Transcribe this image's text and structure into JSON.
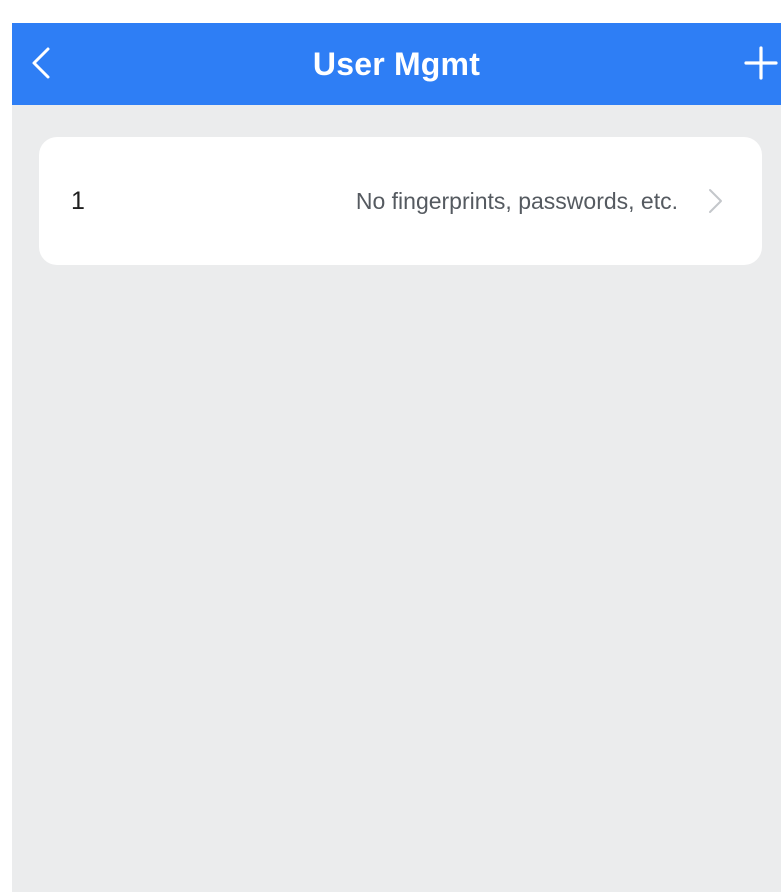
{
  "header": {
    "title": "User Mgmt",
    "back_icon": "chevron-left-icon",
    "add_icon": "plus-icon",
    "background_color": "#2e7ef5"
  },
  "users": [
    {
      "id": "1",
      "status": "No fingerprints, passwords, etc.",
      "chevron_icon": "chevron-right-icon"
    }
  ]
}
